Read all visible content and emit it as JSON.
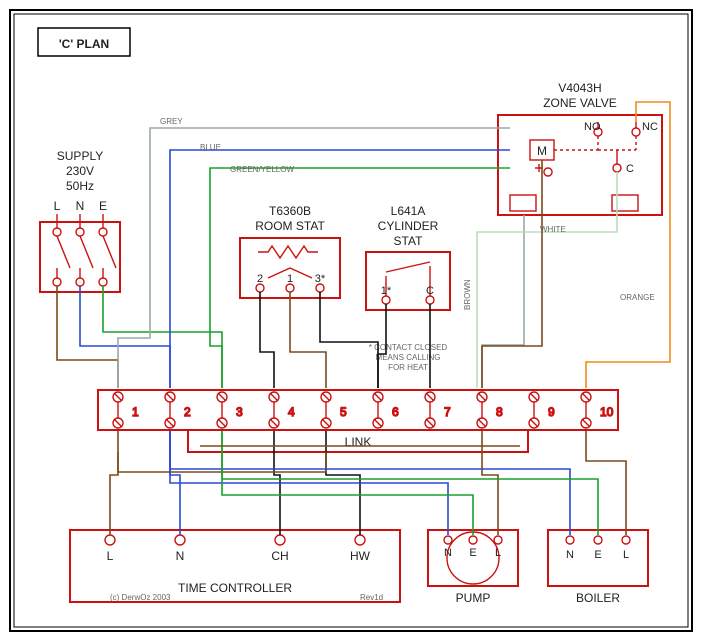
{
  "title": "'C' PLAN",
  "supply": {
    "label": "SUPPLY",
    "voltage": "230V",
    "freq": "50Hz",
    "L": "L",
    "N": "N",
    "E": "E"
  },
  "roomstat": {
    "model": "T6360B",
    "name": "ROOM STAT",
    "t1": "2",
    "t2": "1",
    "t3": "3*"
  },
  "cylstat": {
    "model": "L641A",
    "name1": "CYLINDER",
    "name2": "STAT",
    "t1": "1*",
    "t2": "C",
    "note1": "* CONTACT CLOSED",
    "note2": "MEANS CALLING",
    "note3": "FOR HEAT"
  },
  "zonevalve": {
    "model": "V4043H",
    "name": "ZONE VALVE",
    "no": "NO",
    "nc": "NC",
    "c": "C",
    "m": "M"
  },
  "junction": {
    "link": "LINK",
    "n1": "1",
    "n2": "2",
    "n3": "3",
    "n4": "4",
    "n5": "5",
    "n6": "6",
    "n7": "7",
    "n8": "8",
    "n9": "9",
    "n10": "10"
  },
  "timecontroller": {
    "name": "TIME CONTROLLER",
    "L": "L",
    "N": "N",
    "CH": "CH",
    "HW": "HW",
    "copyright": "(c) DerwOz 2003",
    "rev": "Rev1d"
  },
  "pump": {
    "name": "PUMP",
    "N": "N",
    "E": "E",
    "L": "L"
  },
  "boiler": {
    "name": "BOILER",
    "N": "N",
    "E": "E",
    "L": "L"
  },
  "wire_labels": {
    "grey": "GREY",
    "blue": "BLUE",
    "greenyellow": "GREEN/YELLOW",
    "brown": "BROWN",
    "white": "WHITE",
    "orange": "ORANGE"
  },
  "colors": {
    "red": "#c11",
    "brown": "#7a4a1a",
    "blue": "#2a49d6",
    "black": "#111",
    "greenyellow": "#1aa02a",
    "grey": "#9aa",
    "orange": "#f08a1c",
    "white": "#bdb"
  }
}
